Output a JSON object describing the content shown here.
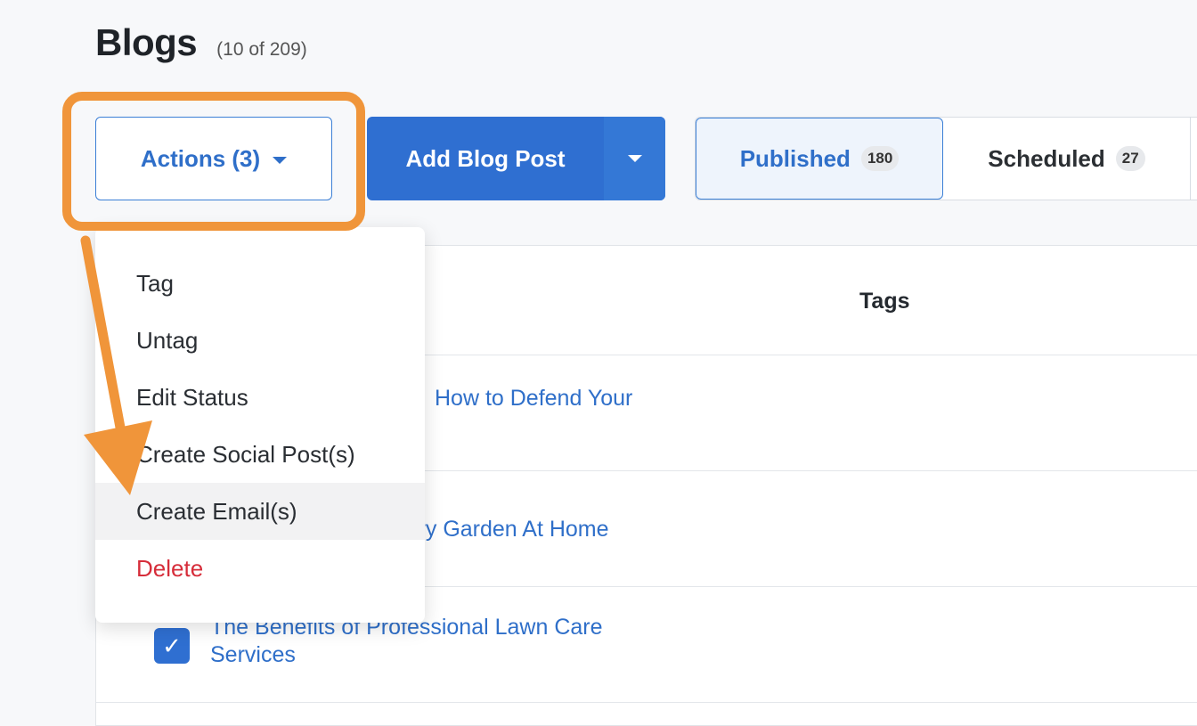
{
  "page": {
    "title": "Blogs",
    "count_label": "(10 of 209)"
  },
  "toolbar": {
    "actions_label": "Actions (3)",
    "add_label": "Add Blog Post"
  },
  "tabs": [
    {
      "label": "Published",
      "count": "180",
      "active": true
    },
    {
      "label": "Scheduled",
      "count": "27",
      "active": false
    }
  ],
  "table": {
    "columns": {
      "tags": "Tags"
    },
    "rows": [
      {
        "title": "How to Defend Your",
        "checked": true
      },
      {
        "title": "iry Garden At Home",
        "checked": true
      },
      {
        "title": "The Benefits of Professional Lawn Care Services",
        "checked": true
      }
    ]
  },
  "actions_menu": {
    "items": [
      {
        "label": "Tag"
      },
      {
        "label": "Untag"
      },
      {
        "label": "Edit Status"
      },
      {
        "label": "Create Social Post(s)"
      },
      {
        "label": "Create Email(s)",
        "hovered": true
      },
      {
        "label": "Delete",
        "danger": true
      }
    ]
  },
  "colors": {
    "accent": "#2f6fd1",
    "highlight": "#f0953a",
    "danger": "#d62d3a"
  },
  "icons": {
    "checkbox": "check-icon",
    "dropdown": "chevron-down-icon"
  }
}
